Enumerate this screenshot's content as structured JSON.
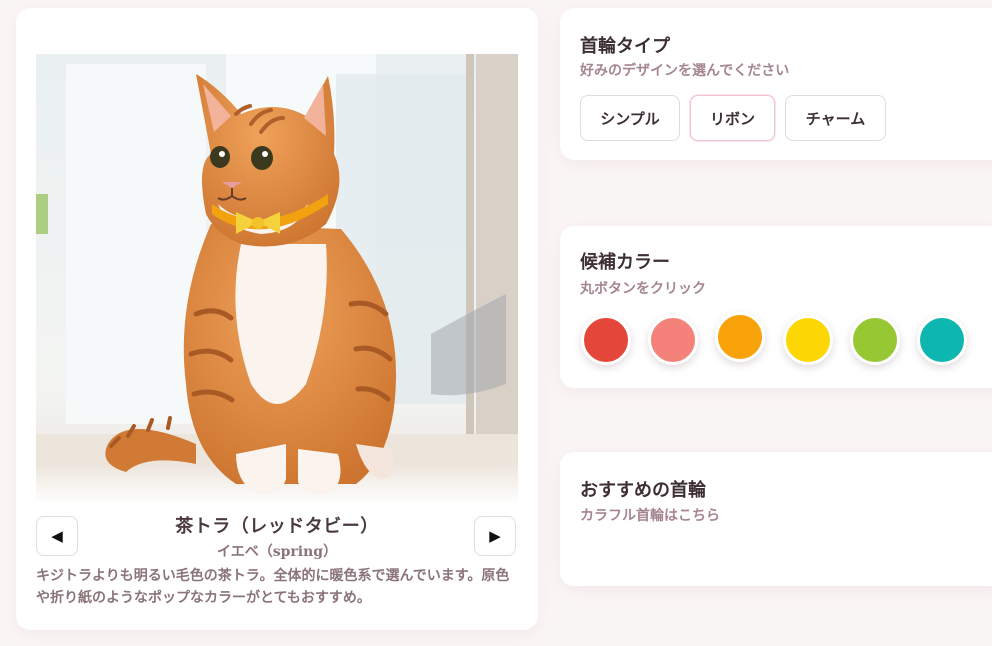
{
  "cat": {
    "name": "茶トラ（レッドタビー）",
    "season": "イエベ（spring）",
    "description": "キジトラよりも明るい毛色の茶トラ。全体的に暖色系で選んでいます。原色や折り紙のようなポップなカラーがとてもおすすめ。",
    "collar_color": "#f2a20e",
    "bow_color": "#f5d23c"
  },
  "nav": {
    "prev_icon": "◀",
    "next_icon": "▶"
  },
  "collar_type": {
    "title": "首輪タイプ",
    "subtitle": "好みのデザインを選んでください",
    "options": [
      "シンプル",
      "リボン",
      "チャーム"
    ],
    "selected": "リボン"
  },
  "colors": {
    "title": "候補カラー",
    "subtitle": "丸ボタンをクリック",
    "swatches": [
      "#e4473a",
      "#f4827a",
      "#f8a20a",
      "#fcd705",
      "#97c732",
      "#0db7b0"
    ]
  },
  "recommend": {
    "title": "おすすめの首輪",
    "subtitle": "カラフル首輪はこちら"
  }
}
